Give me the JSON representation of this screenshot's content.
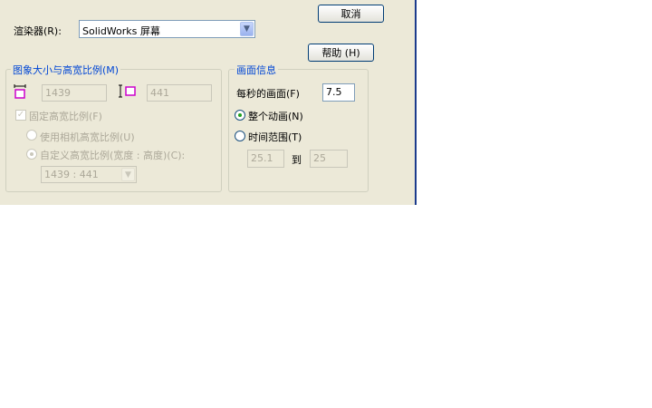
{
  "buttons": {
    "cancel": "取消",
    "help": "帮助 (H)"
  },
  "renderer": {
    "label": "渲染器(R):",
    "value": "SolidWorks 屏幕"
  },
  "image_size": {
    "title": "图象大小与高宽比例(M)",
    "width_value": "1439",
    "height_value": "441",
    "fixed_ratio_label": "固定高宽比例(F)",
    "use_camera_ratio_label": "使用相机高宽比例(U)",
    "custom_ratio_label": "自定义高宽比例(宽度 : 高度)(C):",
    "custom_ratio_value": "1439 : 441"
  },
  "frame_info": {
    "title": "画面信息",
    "fps_label": "每秒的画面(F)",
    "fps_value": "7.5",
    "entire_animation_label": "整个动画(N)",
    "time_range_label": "时间范围(T)",
    "time_from": "25.1",
    "to_label": "到",
    "time_to": "25"
  },
  "icons": [
    "width-ratio-icon",
    "height-ratio-icon",
    "chevron-down-icon"
  ],
  "colors": {
    "dialog_bg": "#ece9d8",
    "group_title": "#0046d5",
    "border_blue": "#003c74"
  }
}
